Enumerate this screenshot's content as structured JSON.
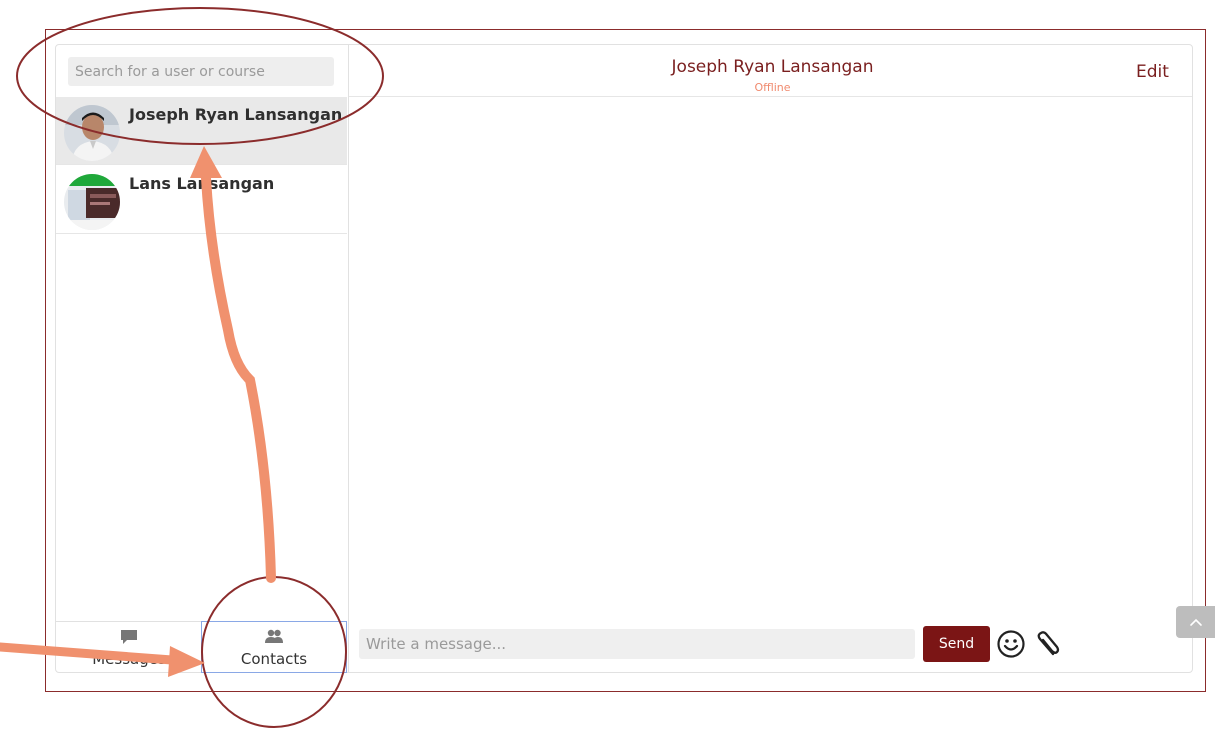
{
  "sidebar": {
    "search_placeholder": "Search for a user or course",
    "contacts": [
      {
        "name": "Joseph Ryan Lansangan",
        "selected": true
      },
      {
        "name": "Lans Lansangan",
        "selected": false
      }
    ],
    "tabs": [
      {
        "label": "Messages",
        "icon": "message-icon"
      },
      {
        "label": "Contacts",
        "icon": "contacts-icon",
        "active": true
      }
    ]
  },
  "conversation": {
    "name": "Joseph Ryan Lansangan",
    "status": "Offline",
    "edit_label": "Edit"
  },
  "composer": {
    "placeholder": "Write a message...",
    "send_label": "Send",
    "emoji_icon": "smiley-icon",
    "attach_icon": "paperclip-icon"
  },
  "colors": {
    "brand": "#7b1515",
    "status_offline": "#f08a6e",
    "annotation_arrow": "#f0916e",
    "annotation_circle": "#8b2c2c"
  }
}
